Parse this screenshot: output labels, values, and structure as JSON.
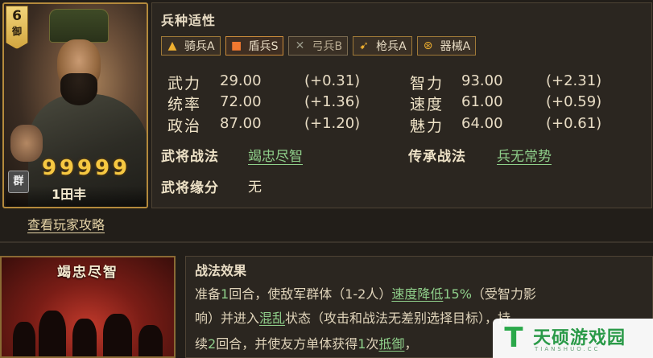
{
  "general": {
    "level": "6",
    "kind": "御",
    "faction": "群",
    "name": "1田丰",
    "stars": [
      "9",
      "9",
      "9",
      "9",
      "9"
    ],
    "guide_link": "查看玩家攻略"
  },
  "troops": {
    "title": "兵种适性",
    "items": [
      {
        "icon": "cavalry-icon",
        "glyph": "▲",
        "label": "骑兵A",
        "grade": "A"
      },
      {
        "icon": "shield-icon",
        "glyph": "■",
        "label": "盾兵S",
        "grade": "S"
      },
      {
        "icon": "bow-icon",
        "glyph": "✕",
        "label": "弓兵B",
        "grade": "B"
      },
      {
        "icon": "spear-icon",
        "glyph": "➹",
        "label": "枪兵A",
        "grade": "A"
      },
      {
        "icon": "siege-icon",
        "glyph": "⊛",
        "label": "器械A",
        "grade": "A"
      }
    ]
  },
  "stats": {
    "left": [
      {
        "label": "武力",
        "value": "29.00",
        "growth": "(+0.31)"
      },
      {
        "label": "统率",
        "value": "72.00",
        "growth": "(+1.36)"
      },
      {
        "label": "政治",
        "value": "87.00",
        "growth": "(+1.20)"
      }
    ],
    "right": [
      {
        "label": "智力",
        "value": "93.00",
        "growth": "(+2.31)"
      },
      {
        "label": "速度",
        "value": "61.00",
        "growth": "(+0.59)"
      },
      {
        "label": "魅力",
        "value": "64.00",
        "growth": "(+0.61)"
      }
    ]
  },
  "skills": {
    "general_skill_label": "武将战法",
    "general_skill": "竭忠尽智",
    "inherit_skill_label": "传承战法",
    "inherit_skill": "兵无常势",
    "bond_label": "武将缘分",
    "bond_value": "无"
  },
  "skill_detail": {
    "card_title": "竭忠尽智",
    "effect_title": "战法效果",
    "line1": {
      "a": "准备",
      "n1": "1",
      "b": "回合，使敌军群体（1-2人）",
      "link1": "速度降低",
      "n2": "15%",
      "c": "（受智力影"
    },
    "line2": {
      "a": "响）并进入",
      "link1": "混乱",
      "b": "状态（攻击和战法无差别选择目标），持"
    },
    "line3": {
      "a": "续",
      "n1": "2",
      "b": "回合，并使友方单体获得",
      "n2": "1",
      "c": "次",
      "link1": "抵御",
      "d": "，"
    }
  },
  "watermark": {
    "logo": "T",
    "text": "天硕游戏园",
    "sub": "TIANSHUO.CC"
  }
}
